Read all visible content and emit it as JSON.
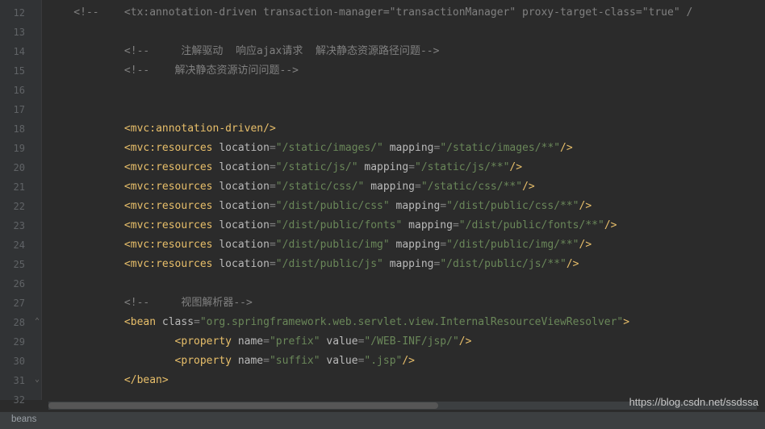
{
  "gutter": {
    "start": 12,
    "end": 32,
    "foldOpen": [
      28,
      31
    ]
  },
  "lines": [
    {
      "n": 12,
      "indent": 0,
      "type": "comment",
      "raw": "<!--    <tx:annotation-driven transaction-manager=\"transactionManager\" proxy-target-class=\"true\" /"
    },
    {
      "n": 13,
      "indent": 0,
      "type": "blank"
    },
    {
      "n": 14,
      "indent": 2,
      "type": "comment",
      "raw": "<!--     注解驱动  响应ajax请求  解决静态资源路径问题-->"
    },
    {
      "n": 15,
      "indent": 2,
      "type": "comment",
      "raw": "<!--    解决静态资源访问问题-->"
    },
    {
      "n": 16,
      "indent": 0,
      "type": "blank"
    },
    {
      "n": 17,
      "indent": 0,
      "type": "blank"
    },
    {
      "n": 18,
      "indent": 2,
      "type": "selfclose",
      "ns": "mvc",
      "tag": "annotation-driven",
      "attrs": []
    },
    {
      "n": 19,
      "indent": 2,
      "type": "selfclose",
      "ns": "mvc",
      "tag": "resources",
      "attrs": [
        [
          "location",
          "/static/images/"
        ],
        [
          "mapping",
          "/static/images/**"
        ]
      ]
    },
    {
      "n": 20,
      "indent": 2,
      "type": "selfclose",
      "ns": "mvc",
      "tag": "resources",
      "attrs": [
        [
          "location",
          "/static/js/"
        ],
        [
          "mapping",
          "/static/js/**"
        ]
      ]
    },
    {
      "n": 21,
      "indent": 2,
      "type": "selfclose",
      "ns": "mvc",
      "tag": "resources",
      "attrs": [
        [
          "location",
          "/static/css/"
        ],
        [
          "mapping",
          "/static/css/**"
        ]
      ]
    },
    {
      "n": 22,
      "indent": 2,
      "type": "selfclose",
      "ns": "mvc",
      "tag": "resources",
      "attrs": [
        [
          "location",
          "/dist/public/css"
        ],
        [
          "mapping",
          "/dist/public/css/**"
        ]
      ]
    },
    {
      "n": 23,
      "indent": 2,
      "type": "selfclose",
      "ns": "mvc",
      "tag": "resources",
      "attrs": [
        [
          "location",
          "/dist/public/fonts"
        ],
        [
          "mapping",
          "/dist/public/fonts/**"
        ]
      ]
    },
    {
      "n": 24,
      "indent": 2,
      "type": "selfclose",
      "ns": "mvc",
      "tag": "resources",
      "attrs": [
        [
          "location",
          "/dist/public/img"
        ],
        [
          "mapping",
          "/dist/public/img/**"
        ]
      ]
    },
    {
      "n": 25,
      "indent": 2,
      "type": "selfclose",
      "ns": "mvc",
      "tag": "resources",
      "attrs": [
        [
          "location",
          "/dist/public/js"
        ],
        [
          "mapping",
          "/dist/public/js/**"
        ]
      ]
    },
    {
      "n": 26,
      "indent": 0,
      "type": "blank"
    },
    {
      "n": 27,
      "indent": 2,
      "type": "comment",
      "raw": "<!--     视图解析器-->"
    },
    {
      "n": 28,
      "indent": 2,
      "type": "open",
      "ns": "",
      "tag": "bean",
      "attrs": [
        [
          "class",
          "org.springframework.web.servlet.view.InternalResourceViewResolver"
        ]
      ]
    },
    {
      "n": 29,
      "indent": 4,
      "type": "selfclose",
      "ns": "",
      "tag": "property",
      "attrs": [
        [
          "name",
          "prefix"
        ],
        [
          "value",
          "/WEB-INF/jsp/"
        ]
      ]
    },
    {
      "n": 30,
      "indent": 4,
      "type": "selfclose",
      "ns": "",
      "tag": "property",
      "attrs": [
        [
          "name",
          "suffix"
        ],
        [
          "value",
          ".jsp"
        ]
      ]
    },
    {
      "n": 31,
      "indent": 2,
      "type": "close",
      "ns": "",
      "tag": "bean"
    },
    {
      "n": 32,
      "indent": 0,
      "type": "blank"
    }
  ],
  "breadcrumb": "beans",
  "watermark": "https://blog.csdn.net/ssdssa"
}
